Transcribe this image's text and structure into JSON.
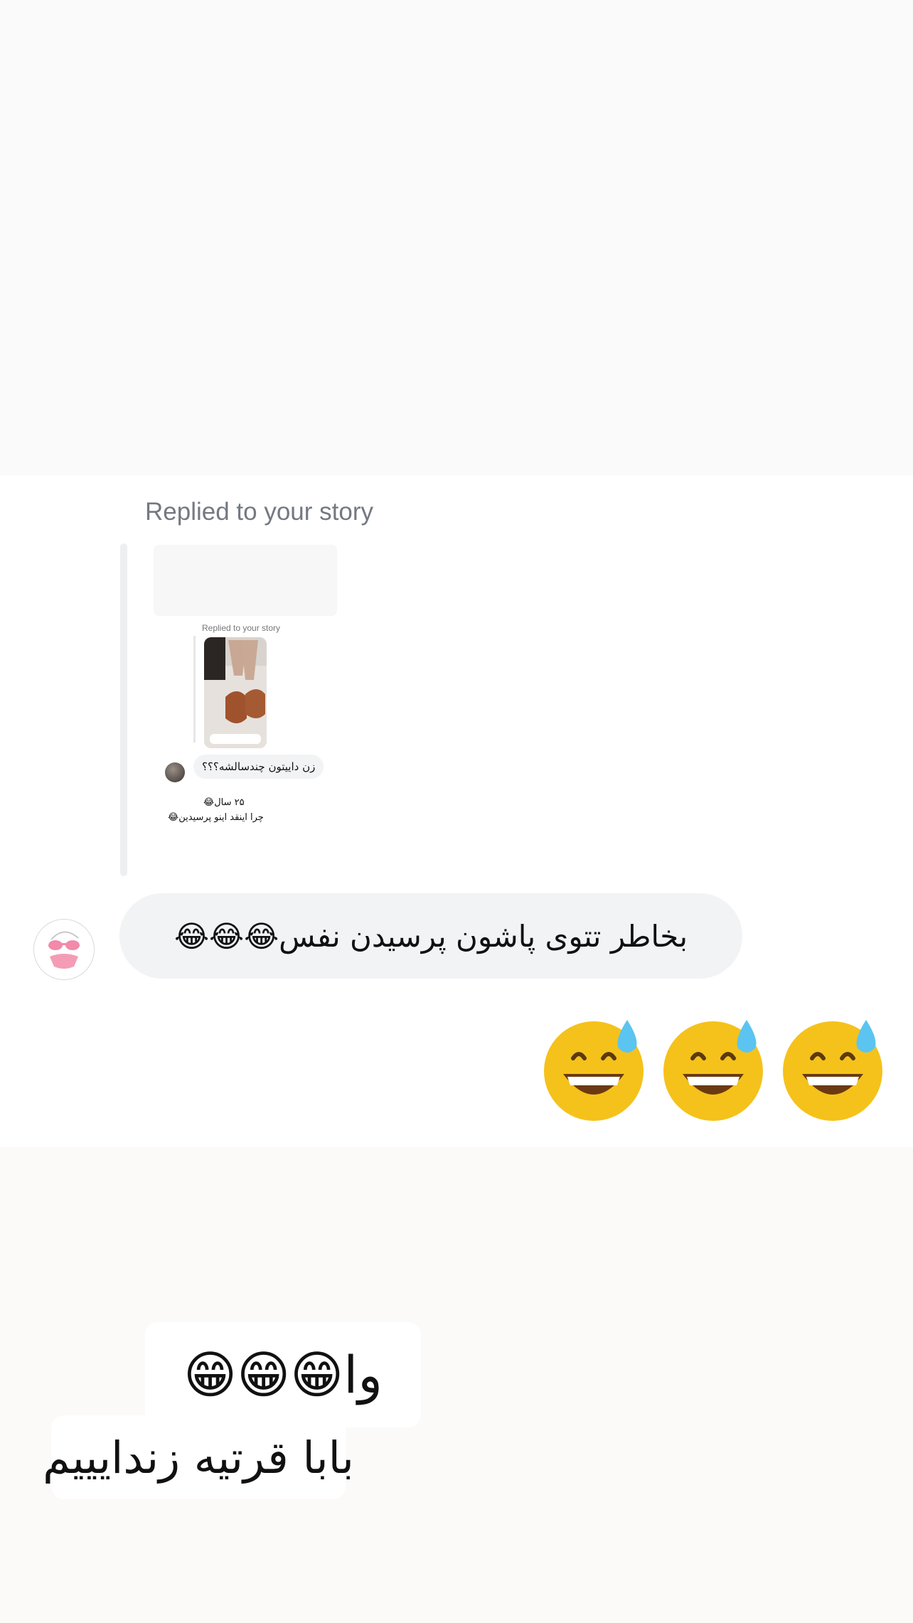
{
  "reply_header": "Replied to your story",
  "nested_preview": {
    "reply_header": "Replied to your story",
    "message": "زن داییتون چندسالشه؟؟؟",
    "reply_line1": "۲۵ سال😂",
    "reply_line2": "چرا اینقد اینو پرسیدین😂"
  },
  "message": "بخاطر تتوی پاشون پرسیدن نفس😂😂😂",
  "sticker_line1": "وا😁😁😁",
  "sticker_line2": "بابا قرتیه زندایییم",
  "big_emoji_count": 3,
  "colors": {
    "bubble": "#f2f3f5",
    "header_text": "#737982",
    "quote_bar": "#eeeff1"
  },
  "icons": {
    "avatar": "pink-sunglasses-avatar-icon",
    "big_emoji": "grinning-sweat-face-icon"
  }
}
